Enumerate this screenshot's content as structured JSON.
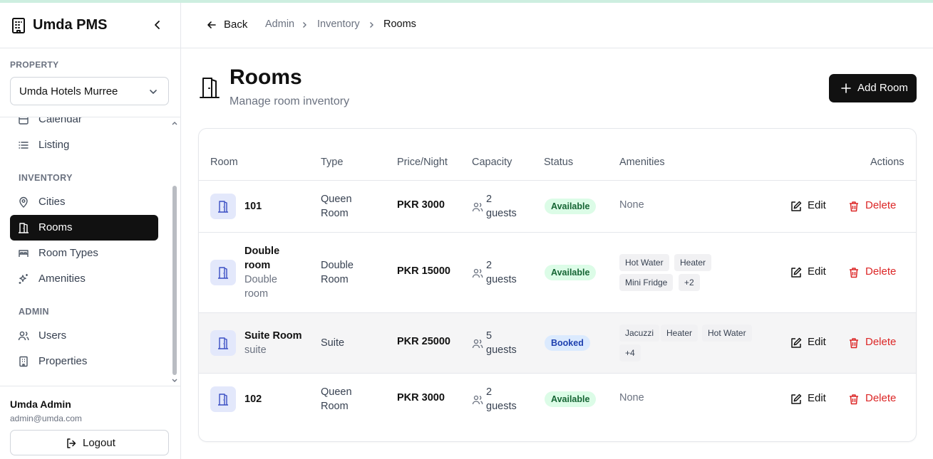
{
  "app": {
    "title": "Umda PMS"
  },
  "sidebar": {
    "property_label": "PROPERTY",
    "property_value": "Umda Hotels Murree",
    "items": [
      {
        "label": "Calendar"
      },
      {
        "label": "Listing"
      },
      {
        "label": "Cities"
      },
      {
        "label": "Rooms"
      },
      {
        "label": "Room Types"
      },
      {
        "label": "Amenities"
      },
      {
        "label": "Users"
      },
      {
        "label": "Properties"
      }
    ],
    "sections": {
      "inventory": "INVENTORY",
      "admin": "ADMIN"
    },
    "user": {
      "name": "Umda Admin",
      "email": "admin@umda.com"
    },
    "logout_label": "Logout"
  },
  "header": {
    "back_label": "Back",
    "breadcrumb": [
      "Admin",
      "Inventory",
      "Rooms"
    ]
  },
  "page": {
    "title": "Rooms",
    "subtitle": "Manage room inventory",
    "add_label": "Add Room"
  },
  "table": {
    "columns": [
      "Room",
      "Type",
      "Price/Night",
      "Capacity",
      "Status",
      "Amenities",
      "Actions"
    ],
    "edit_label": "Edit",
    "delete_label": "Delete",
    "none_label": "None",
    "rows": [
      {
        "name": "101",
        "type_1": "Queen",
        "type_2": "Room",
        "price": "PKR 3000",
        "cap_1": "2",
        "cap_2": "guests",
        "status": "Available"
      },
      {
        "name_1": "Double",
        "name_2": "room",
        "desc_1": "Double",
        "desc_2": "room",
        "type_1": "Double",
        "type_2": "Room",
        "price": "PKR 15000",
        "cap_1": "2",
        "cap_2": "guests",
        "status": "Available",
        "amenities": [
          "Hot Water",
          "Heater",
          "Mini Fridge",
          "+2"
        ]
      },
      {
        "name": "Suite Room",
        "desc": "suite",
        "type_1": "Suite",
        "price": "PKR 25000",
        "cap_1": "5",
        "cap_2": "guests",
        "status": "Booked",
        "amenities": [
          "Jacuzzi",
          "Heater",
          "Hot Water",
          "+4"
        ]
      },
      {
        "name": "102",
        "type_1": "Queen",
        "type_2": "Room",
        "price": "PKR 3000",
        "cap_1": "2",
        "cap_2": "guests",
        "status": "Available"
      }
    ]
  },
  "colors": {
    "accent": "#111111",
    "delete": "#dc2626",
    "available_bg": "#dcfce7",
    "booked_bg": "#dbeafe",
    "room_icon_bg": "#e3e8fb"
  }
}
